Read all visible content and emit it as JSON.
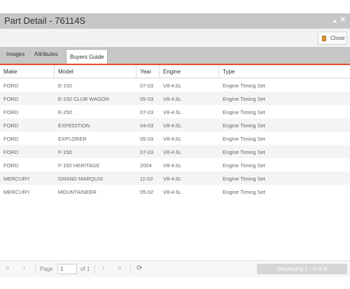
{
  "window": {
    "title": "Part Detail - 76114S",
    "maximize_icon": "caret-up-icon",
    "close_icon": "close-x-icon"
  },
  "toolbar": {
    "close_label": "Close"
  },
  "tabs": [
    {
      "label": "Images",
      "active": false
    },
    {
      "label": "Attributes",
      "active": false
    },
    {
      "label": "Buyers Guide",
      "active": true
    }
  ],
  "grid": {
    "columns": [
      "Make",
      "Model",
      "Year",
      "Engine",
      "Type"
    ],
    "rows": [
      [
        "FORD",
        "E-150",
        "07-03",
        "V8-4.6L",
        "Engine Timing Set"
      ],
      [
        "FORD",
        "E-150 CLUB WAGON",
        "05-03",
        "V8-4.6L",
        "Engine Timing Set"
      ],
      [
        "FORD",
        "E-250",
        "07-03",
        "V8-4.6L",
        "Engine Timing Set"
      ],
      [
        "FORD",
        "EXPEDITION",
        "04-03",
        "V8-4.6L",
        "Engine Timing Set"
      ],
      [
        "FORD",
        "EXPLORER",
        "05-03",
        "V8-4.6L",
        "Engine Timing Set"
      ],
      [
        "FORD",
        "F-150",
        "07-03",
        "V8-4.6L",
        "Engine Timing Set"
      ],
      [
        "FORD",
        "F-150 HERITAGE",
        "2004",
        "V8-4.6L",
        "Engine Timing Set"
      ],
      [
        "MERCURY",
        "GRAND MARQUIS",
        "11-02",
        "V8-4.6L",
        "Engine Timing Set"
      ],
      [
        "MERCURY",
        "MOUNTAINEER",
        "05-02",
        "V8-4.6L",
        "Engine Timing Set"
      ]
    ]
  },
  "pager": {
    "page_label": "Page",
    "page_value": "1",
    "of_label": "of 1",
    "status": "Displaying 1 - 9 of 9",
    "first_glyph": "«",
    "prev_glyph": "‹",
    "next_glyph": "›",
    "last_glyph": "»",
    "refresh_glyph": "⟳"
  },
  "colors": {
    "accent_line": "#e64a2e",
    "title_bar": "#c7c7c7"
  }
}
